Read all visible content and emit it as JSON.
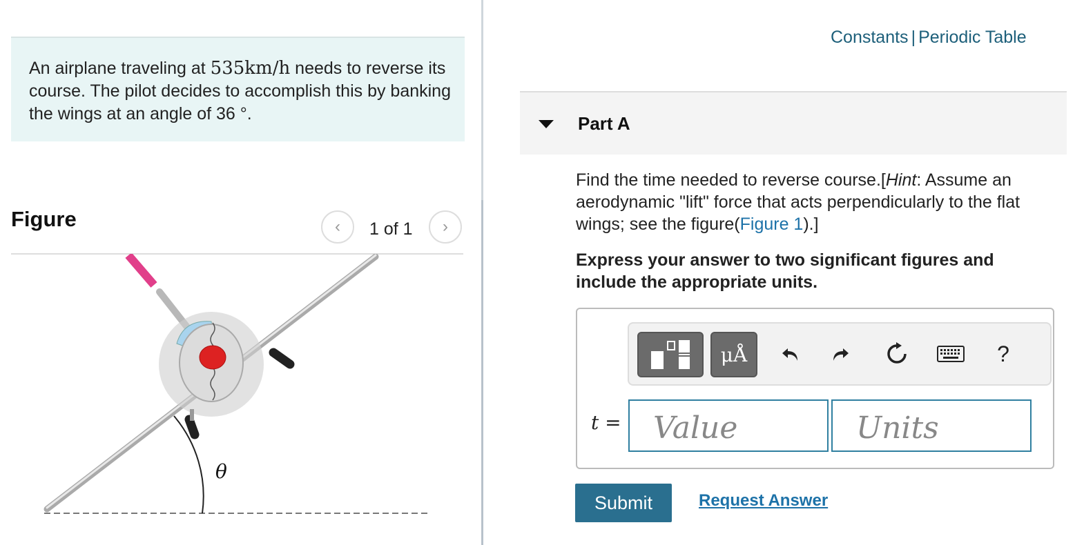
{
  "problem": {
    "text_before": "An airplane traveling at ",
    "speed_math": "535km/h",
    "text_after": " needs to reverse its course. The pilot decides to accomplish this by banking the wings at an angle of 36 °."
  },
  "figure": {
    "heading": "Figure",
    "pager": "1 of 1",
    "angle_label": "θ"
  },
  "header_links": {
    "constants": "Constants",
    "separator": "|",
    "periodic_table": "Periodic Table"
  },
  "part": {
    "title": "Part A",
    "question_before": "Find the time needed to reverse course.[",
    "hint_word": "Hint",
    "question_middle": ": Assume an aerodynamic \"lift\" force that acts perpendicularly to the flat wings; see the figure(",
    "figure_link": "Figure 1",
    "question_after": ").]",
    "instruction": "Express your answer to two significant figures and include the appropriate units."
  },
  "answer": {
    "variable": "t",
    "equals": "=",
    "value_placeholder": "Value",
    "units_placeholder": "Units",
    "toolbar": {
      "units_button": "μÅ",
      "help": "?"
    }
  },
  "actions": {
    "submit": "Submit",
    "request_answer": "Request Answer"
  }
}
